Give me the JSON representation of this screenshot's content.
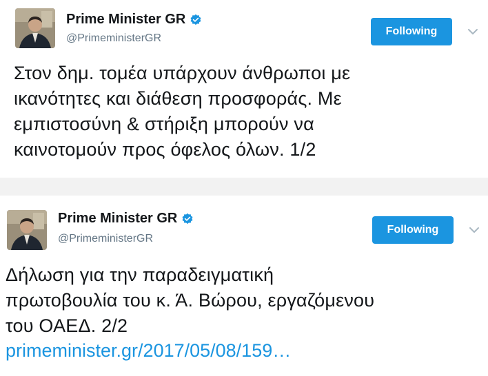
{
  "tweets": [
    {
      "display_name": "Prime Minister GR",
      "handle": "@PrimeministerGR",
      "follow_label": "Following",
      "text": "Στον δημ. τομέα υπάρχουν άνθρωποι με\nικανότητες και διάθεση προσφοράς. Με\nεμπιστοσύνη & στήριξη μπορούν να\nκαινοτομούν προς όφελος όλων. 1/2"
    },
    {
      "display_name": "Prime Minister GR",
      "handle": "@PrimeministerGR",
      "follow_label": "Following",
      "text": "Δήλωση για την παραδειγματική\nπρωτοβουλία του κ. Ά. Βώρου, εργαζόμενου\nτου ΟΑΕΔ. 2/2",
      "link": "primeminister.gr/2017/05/08/159…"
    }
  ],
  "icons": {
    "verified": "verified-badge-icon",
    "chevron": "chevron-down-icon",
    "avatar": "profile-avatar"
  },
  "colors": {
    "accent": "#1b95e0",
    "text": "#14171a",
    "secondary": "#657786",
    "separator": "#f2f2f2"
  }
}
